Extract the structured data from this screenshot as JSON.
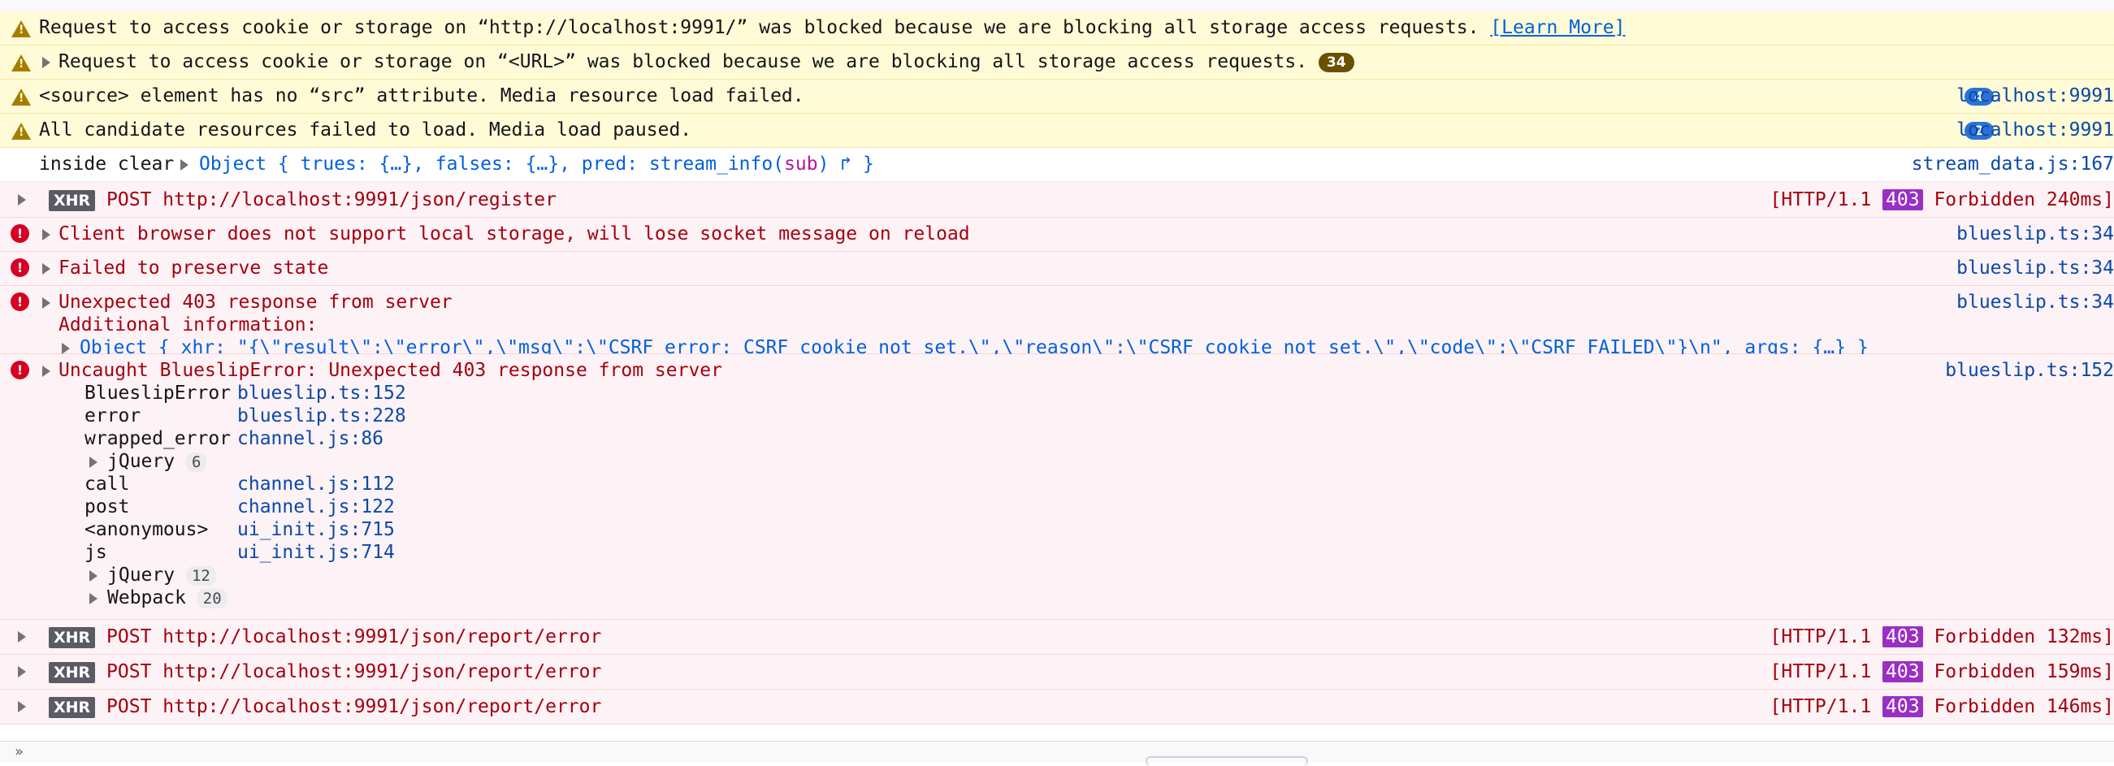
{
  "messages": {
    "warn1": {
      "text": "Request to access cookie or storage on “http://localhost:9991/” was blocked because we are blocking all storage access requests.",
      "link": "[Learn More]"
    },
    "warn2": {
      "text": "Request to access cookie or storage on “<URL>” was blocked because we are blocking all storage access requests.",
      "count": "34"
    },
    "warn3": {
      "text": "<source> element has no “src” attribute. Media resource load failed.",
      "count": "4",
      "source": "localhost:9991"
    },
    "warn4": {
      "text": "All candidate resources failed to load. Media load paused.",
      "count": "2",
      "source": "localhost:9991"
    },
    "log1": {
      "label": "inside clear",
      "object_open": "Object { trues: {…}, falses: {…}, pred: stream_info(",
      "object_arg": "sub",
      "object_close": ") ↱ }",
      "source": "stream_data.js:167"
    },
    "xhr_register": {
      "tag": "XHR",
      "method": "POST",
      "url": "http://localhost:9991/json/register",
      "protocol": "[HTTP/1.1",
      "status": "403",
      "status_text": "Forbidden 240ms]"
    },
    "err1": {
      "text": "Client browser does not support local storage, will lose socket message on reload",
      "source": "blueslip.ts:34"
    },
    "err2": {
      "text": "Failed to preserve state",
      "source": "blueslip.ts:34"
    },
    "err3": {
      "text": "Unexpected 403 response from server",
      "additional": "Additional information:",
      "object": "Object { xhr: \"{\\\"result\\\":\\\"error\\\",\\\"msg\\\":\\\"CSRF error: CSRF cookie not set.\\\",\\\"reason\\\":\\\"CSRF cookie not set.\\\",\\\"code\\\":\\\"CSRF_FAILED\\\"}\\n\", args: {…} }",
      "source": "blueslip.ts:34"
    },
    "err4": {
      "text": "Uncaught BlueslipError: Unexpected 403 response from server",
      "source": "blueslip.ts:152",
      "stack": [
        {
          "name": "BlueslipError",
          "location": "blueslip.ts:152"
        },
        {
          "name": "error",
          "location": "blueslip.ts:228"
        },
        {
          "name": "wrapped_error",
          "location": "channel.js:86"
        },
        {
          "group": "jQuery",
          "count": "6"
        },
        {
          "name": "call",
          "location": "channel.js:112"
        },
        {
          "name": "post",
          "location": "channel.js:122"
        },
        {
          "name": "<anonymous>",
          "location": "ui_init.js:715"
        },
        {
          "name": "js",
          "location": "ui_init.js:714"
        },
        {
          "group": "jQuery",
          "count": "12"
        },
        {
          "group": "Webpack",
          "count": "20"
        }
      ]
    },
    "xhr_report": [
      {
        "tag": "XHR",
        "method": "POST",
        "url": "http://localhost:9991/json/report/error",
        "protocol": "[HTTP/1.1",
        "status": "403",
        "status_text": "Forbidden 132ms]"
      },
      {
        "tag": "XHR",
        "method": "POST",
        "url": "http://localhost:9991/json/report/error",
        "protocol": "[HTTP/1.1",
        "status": "403",
        "status_text": "Forbidden 159ms]"
      },
      {
        "tag": "XHR",
        "method": "POST",
        "url": "http://localhost:9991/json/report/error",
        "protocol": "[HTTP/1.1",
        "status": "403",
        "status_text": "Forbidden 146ms]"
      }
    ]
  },
  "bottom": {
    "chevron": "»"
  },
  "colors": {
    "warning_bg": "#fffbd6",
    "error_bg": "#fdf2f5",
    "error_text": "#a4000f",
    "status_403": "#9b2ec4",
    "link": "#0060df"
  }
}
